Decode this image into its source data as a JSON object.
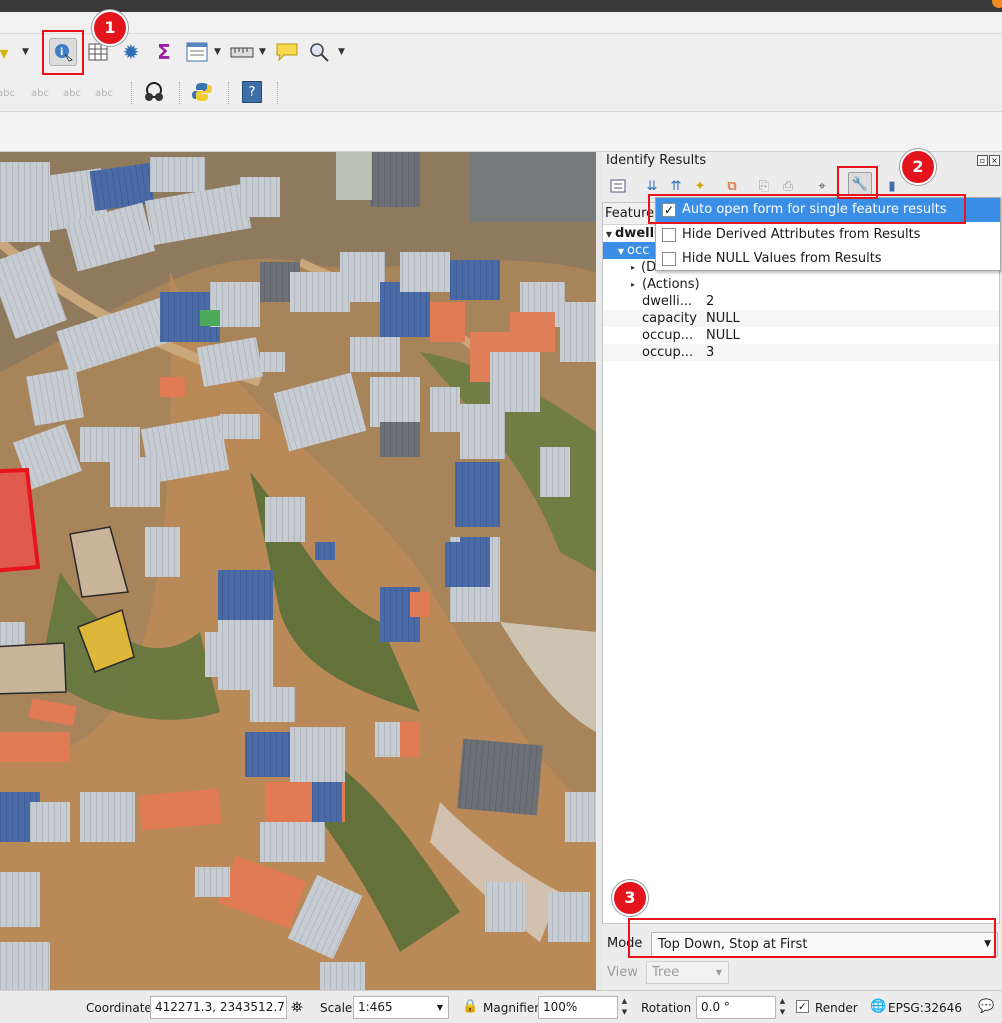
{
  "toolbar": {
    "identify_icon": "identify-features-icon",
    "attribute_table_icon": "open-attribute-table-icon",
    "toolbox_icon": "processing-toolbox-icon",
    "statistics_icon": "statistical-summary-icon",
    "sigma_label": "Σ",
    "help_label": "?"
  },
  "panel": {
    "title": "Identify Results",
    "tree_header": "Feature",
    "layer_name": "dwell",
    "selected_row": "occ",
    "rows": [
      {
        "arrow": "▸",
        "name": "(D",
        "value": ""
      },
      {
        "arrow": "▸",
        "name": "(Actions)",
        "value": ""
      },
      {
        "arrow": "",
        "name": "dwelli...",
        "value": "2"
      },
      {
        "arrow": "",
        "name": "capacity",
        "value": "NULL"
      },
      {
        "arrow": "",
        "name": "occup...",
        "value": "NULL"
      },
      {
        "arrow": "",
        "name": "occup...",
        "value": "3"
      }
    ],
    "mode_label": "Mode",
    "mode_value": "Top Down, Stop at First",
    "view_label": "View",
    "view_value": "Tree"
  },
  "menu": {
    "items": [
      {
        "label": "Auto open form for single feature results",
        "checked": true
      },
      {
        "label": "Hide Derived Attributes from Results",
        "checked": false
      },
      {
        "label": "Hide NULL Values from Results",
        "checked": false
      }
    ]
  },
  "status": {
    "coordinate_label": "Coordinate",
    "coordinate_value": "412271.3, 2343512.7",
    "scale_label": "Scale",
    "scale_value": "1:465",
    "magnifier_label": "Magnifier",
    "magnifier_value": "100%",
    "rotation_label": "Rotation",
    "rotation_value": "0.0 °",
    "render_label": "Render",
    "crs_label": "EPSG:32646"
  },
  "callouts": [
    "1",
    "2",
    "3"
  ],
  "colors": {
    "highlight": "#e8141c",
    "selection": "#3a8ee6",
    "feature_red": "#e05a4e",
    "feature_yellow": "#ddb73a",
    "feature_tan": "#c9b49a"
  }
}
